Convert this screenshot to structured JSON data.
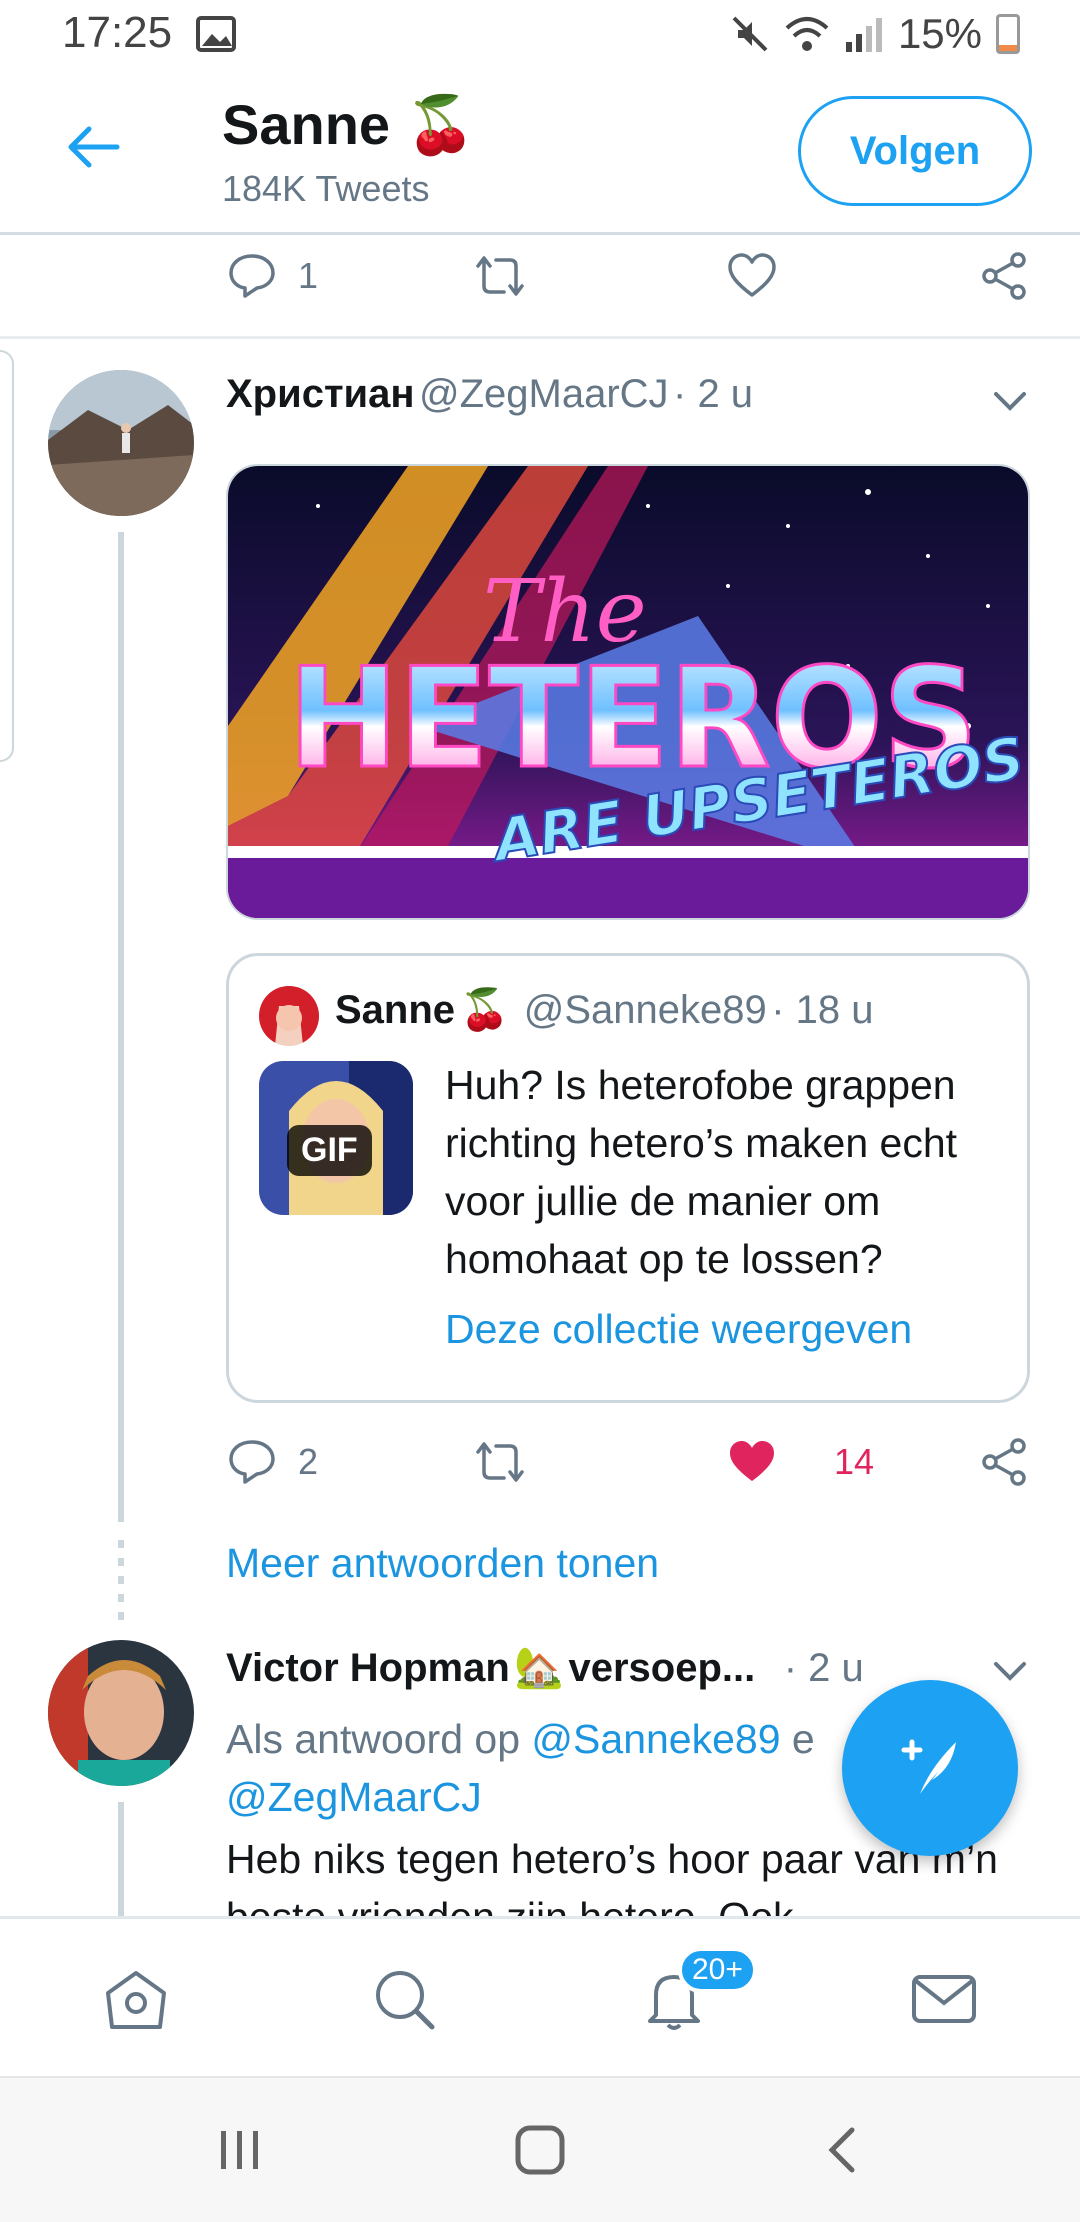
{
  "status_bar": {
    "time": "17:25",
    "battery": "15%"
  },
  "header": {
    "name": "Sanne",
    "emoji": "🍒",
    "subtitle": "184K Tweets",
    "follow_label": "Volgen"
  },
  "top_actions": {
    "reply_count": "1",
    "like_count": ""
  },
  "tweet": {
    "author_name": "Христиан",
    "author_handle": "@ZegMaarCJ",
    "time": "· 2 u",
    "media_text": {
      "line1": "The",
      "line2": "HETEROS",
      "line3": "ARE UPSETEROS"
    },
    "quote": {
      "author_name": "Sanne",
      "author_emoji": "🍒",
      "author_handle": "@Sanneke89",
      "time": "· 18 u",
      "gif_badge": "GIF",
      "text": "Huh? Is heterofobe grappen richting hetero’s maken echt voor jullie de manier om homohaat op te lossen?",
      "link": "Deze collectie weergeven"
    },
    "reply_count": "2",
    "like_count": "14"
  },
  "more_replies": "Meer antwoorden tonen",
  "reply": {
    "author_name": "Victor Hopman",
    "author_emoji": "🏡",
    "author_suffix": "versoep...",
    "time": "· 2 u",
    "in_reply_prefix": "Als antwoord op",
    "in_reply_handle1": "@Sanneke89",
    "in_reply_and": "e",
    "in_reply_handle2": "@ZegMaarCJ",
    "text": "Heb niks tegen hetero’s hoor paar van m’n beste vrienden zijn hetero. Ook"
  },
  "bottom_nav": {
    "notifications_badge": "20+"
  },
  "colors": {
    "accent": "#1da1f2",
    "like": "#e0245e",
    "secondary_text": "#657786"
  }
}
